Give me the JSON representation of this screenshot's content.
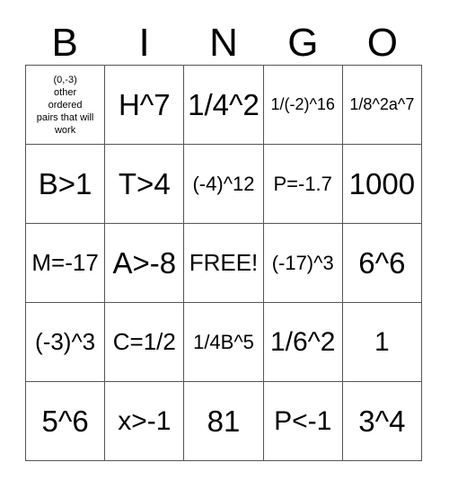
{
  "card": {
    "type": "bingo-card",
    "columns": 5,
    "rows": 5,
    "header": {
      "letters": [
        "B",
        "I",
        "N",
        "G",
        "O"
      ]
    },
    "colors": {
      "background": "#ffffff",
      "text": "#000000",
      "grid_line": "#555555"
    },
    "grid": {
      "rows": [
        {
          "cells": [
            {
              "text": "(0,-3)\nother\nordered\npairs that will\nwork",
              "size": "xs",
              "free": false
            },
            {
              "text": "H^7",
              "size": "xxl",
              "free": false
            },
            {
              "text": "1/4^2",
              "size": "xxl",
              "free": false
            },
            {
              "text": "1/(-2)^16",
              "size": "s",
              "free": false
            },
            {
              "text": "1/8^2a^7",
              "size": "s",
              "free": false
            }
          ]
        },
        {
          "cells": [
            {
              "text": "B>1",
              "size": "xxl",
              "free": false
            },
            {
              "text": "T>4",
              "size": "xxl",
              "free": false
            },
            {
              "text": "(-4)^12",
              "size": "m",
              "free": false
            },
            {
              "text": "P=-1.7",
              "size": "m",
              "free": false
            },
            {
              "text": "1000",
              "size": "xxl",
              "free": false
            }
          ]
        },
        {
          "cells": [
            {
              "text": "M=-17",
              "size": "l",
              "free": false
            },
            {
              "text": "A>-8",
              "size": "xxl",
              "free": false
            },
            {
              "text": "FREE!",
              "size": "l",
              "free": true
            },
            {
              "text": "(-17)^3",
              "size": "m",
              "free": false
            },
            {
              "text": "6^6",
              "size": "xxl",
              "free": false
            }
          ]
        },
        {
          "cells": [
            {
              "text": "(-3)^3",
              "size": "l",
              "free": false
            },
            {
              "text": "C=1/2",
              "size": "l",
              "free": false
            },
            {
              "text": "1/4B^5",
              "size": "m",
              "free": false
            },
            {
              "text": "1/6^2",
              "size": "xl",
              "free": false
            },
            {
              "text": "1",
              "size": "xl",
              "free": false
            }
          ]
        },
        {
          "cells": [
            {
              "text": "5^6",
              "size": "xxl",
              "free": false
            },
            {
              "text": "x>-1",
              "size": "xl",
              "free": false
            },
            {
              "text": "81",
              "size": "xxl",
              "free": false
            },
            {
              "text": "P<-1",
              "size": "xl",
              "free": false
            },
            {
              "text": "3^4",
              "size": "xxl",
              "free": false
            }
          ]
        }
      ]
    }
  }
}
